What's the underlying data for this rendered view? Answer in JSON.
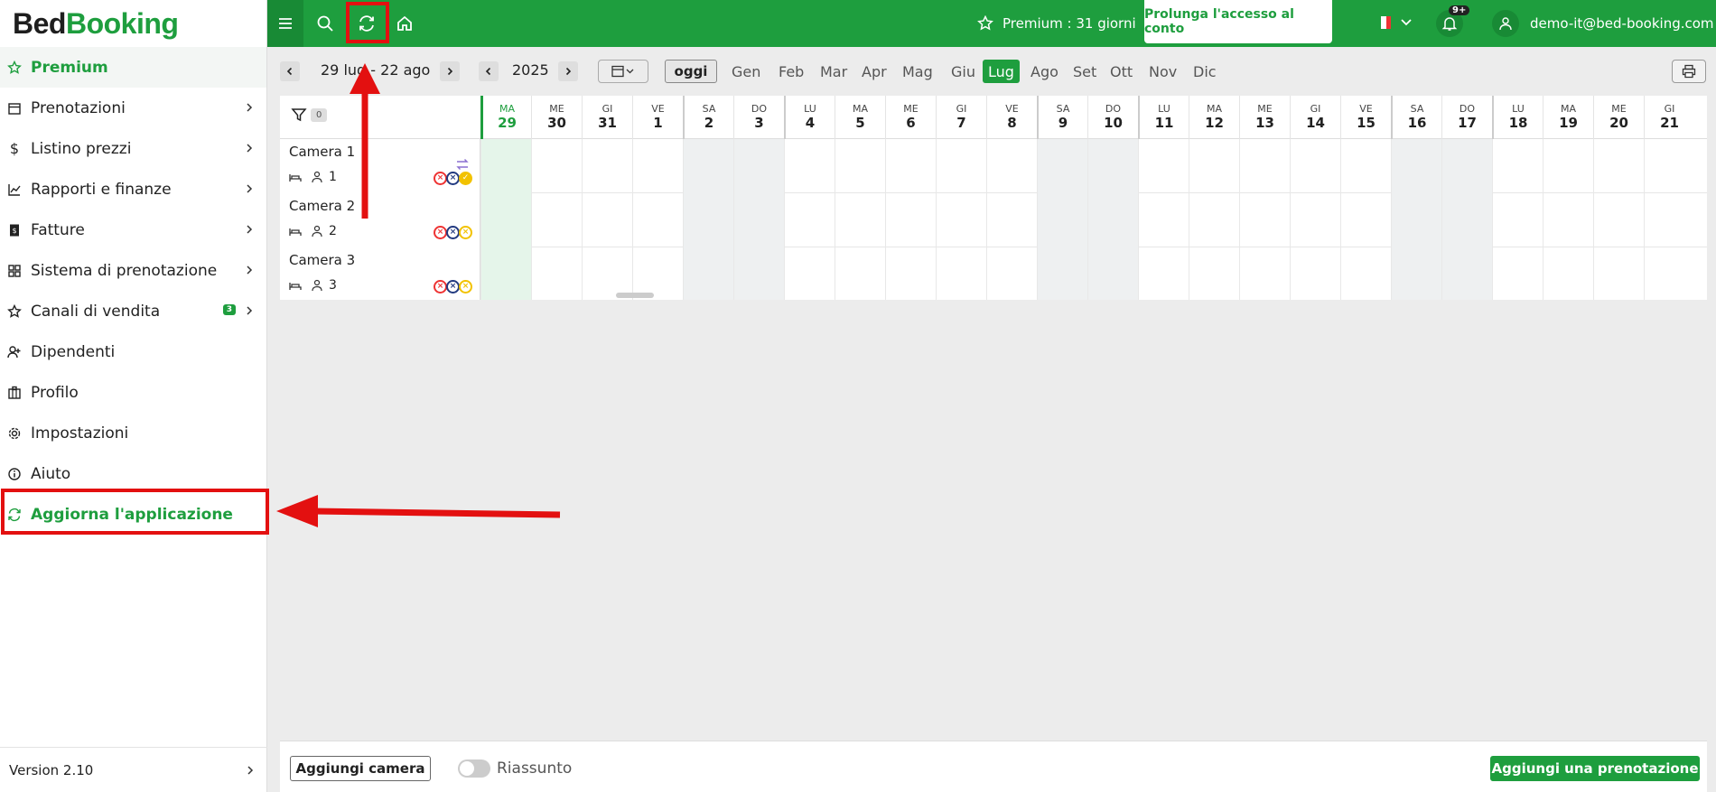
{
  "logo": {
    "part1": "Bed",
    "part2": "Booking"
  },
  "sidebar": {
    "items": [
      {
        "label": "Premium",
        "icon": "star-icon"
      },
      {
        "label": "Prenotazioni",
        "icon": "calendar-icon"
      },
      {
        "label": "Listino prezzi",
        "icon": "dollar-icon"
      },
      {
        "label": "Rapporti e finanze",
        "icon": "chart-icon"
      },
      {
        "label": "Fatture",
        "icon": "invoice-icon"
      },
      {
        "label": "Sistema di prenotazione",
        "icon": "grid-icon"
      },
      {
        "label": "Canali di vendita",
        "icon": "star-outline-icon",
        "badge": "3"
      },
      {
        "label": "Dipendenti",
        "icon": "user-add-icon"
      },
      {
        "label": "Profilo",
        "icon": "building-icon"
      },
      {
        "label": "Impostazioni",
        "icon": "gear-icon"
      },
      {
        "label": "Aiuto",
        "icon": "info-icon"
      },
      {
        "label": "Aggiorna l'applicazione",
        "icon": "refresh-icon"
      }
    ],
    "version": "Version 2.10"
  },
  "topbar": {
    "premium": "Premium : 31 giorni",
    "extend": "Prolunga l'accesso al conto",
    "notifications": "9+",
    "user_email": "demo-it@bed-booking.com"
  },
  "toolbar": {
    "range": "29 lug - 22 ago",
    "year": "2025",
    "today": "oggi",
    "months": [
      "Gen",
      "Feb",
      "Mar",
      "Apr",
      "Mag",
      "Giu",
      "Lug",
      "Ago",
      "Set",
      "Ott",
      "Nov",
      "Dic"
    ],
    "selected_month": "Lug"
  },
  "grid": {
    "filter_count": "0",
    "days": [
      {
        "dn": "MA",
        "dd": "29"
      },
      {
        "dn": "ME",
        "dd": "30"
      },
      {
        "dn": "GI",
        "dd": "31"
      },
      {
        "dn": "VE",
        "dd": "1"
      },
      {
        "dn": "SA",
        "dd": "2"
      },
      {
        "dn": "DO",
        "dd": "3"
      },
      {
        "dn": "LU",
        "dd": "4"
      },
      {
        "dn": "MA",
        "dd": "5"
      },
      {
        "dn": "ME",
        "dd": "6"
      },
      {
        "dn": "GI",
        "dd": "7"
      },
      {
        "dn": "VE",
        "dd": "8"
      },
      {
        "dn": "SA",
        "dd": "9"
      },
      {
        "dn": "DO",
        "dd": "10"
      },
      {
        "dn": "LU",
        "dd": "11"
      },
      {
        "dn": "MA",
        "dd": "12"
      },
      {
        "dn": "ME",
        "dd": "13"
      },
      {
        "dn": "GI",
        "dd": "14"
      },
      {
        "dn": "VE",
        "dd": "15"
      },
      {
        "dn": "SA",
        "dd": "16"
      },
      {
        "dn": "DO",
        "dd": "17"
      },
      {
        "dn": "LU",
        "dd": "18"
      },
      {
        "dn": "MA",
        "dd": "19"
      },
      {
        "dn": "ME",
        "dd": "20"
      },
      {
        "dn": "GI",
        "dd": "21"
      }
    ],
    "rooms": [
      {
        "name": "Camera 1",
        "beds": "1"
      },
      {
        "name": "Camera 2",
        "beds": "2"
      },
      {
        "name": "Camera 3",
        "beds": "3"
      }
    ]
  },
  "bottom": {
    "add_room": "Aggiungi camera",
    "summary": "Riassunto",
    "add_booking": "Aggiungi una prenotazione"
  },
  "colors": {
    "brand": "#1e9e3e",
    "annotation": "#e31010"
  }
}
